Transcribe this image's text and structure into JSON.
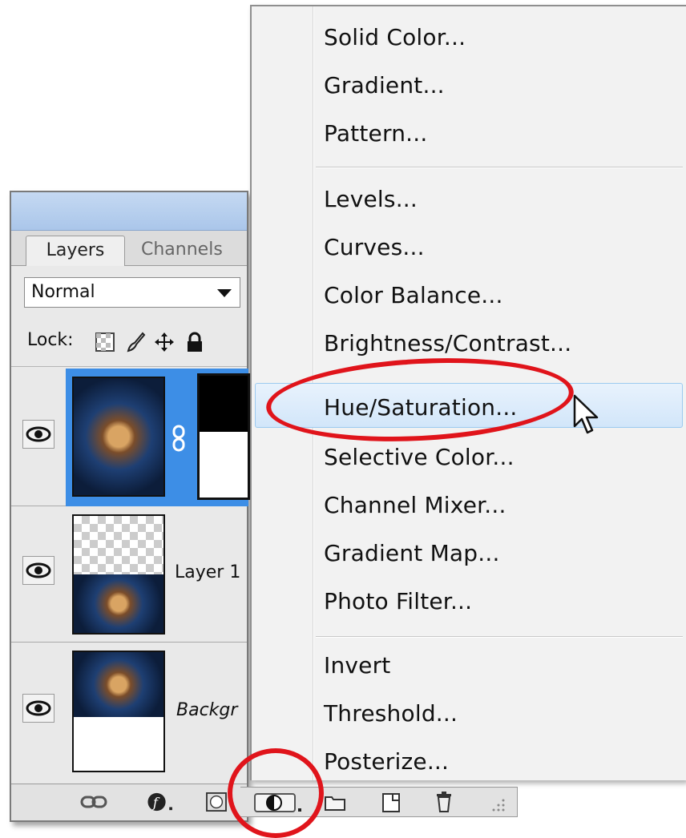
{
  "panel": {
    "tabs": {
      "layers": "Layers",
      "channels": "Channels"
    },
    "blend_mode": "Normal",
    "lock_label": "Lock:",
    "layers": [
      {
        "name": ""
      },
      {
        "name": "Layer 1"
      },
      {
        "name": "Backgr"
      }
    ]
  },
  "menu": {
    "items": [
      "Solid Color...",
      "Gradient...",
      "Pattern...",
      "Levels...",
      "Curves...",
      "Color Balance...",
      "Brightness/Contrast...",
      "Hue/Saturation...",
      "Selective Color...",
      "Channel Mixer...",
      "Gradient Map...",
      "Photo Filter...",
      "Invert",
      "Threshold...",
      "Posterize..."
    ],
    "highlighted": "Hue/Saturation..."
  },
  "colors": {
    "highlight_ring": "#e0141b",
    "layer_selected": "#3d8ee6"
  },
  "icons": [
    "eye-icon",
    "lock-transparency-icon",
    "lock-brush-icon",
    "lock-move-icon",
    "lock-all-icon",
    "link-layers-icon",
    "layer-style-icon",
    "mask-icon",
    "adjustment-layer-icon",
    "folder-icon",
    "new-layer-icon",
    "trash-icon",
    "mouse-cursor-icon"
  ]
}
